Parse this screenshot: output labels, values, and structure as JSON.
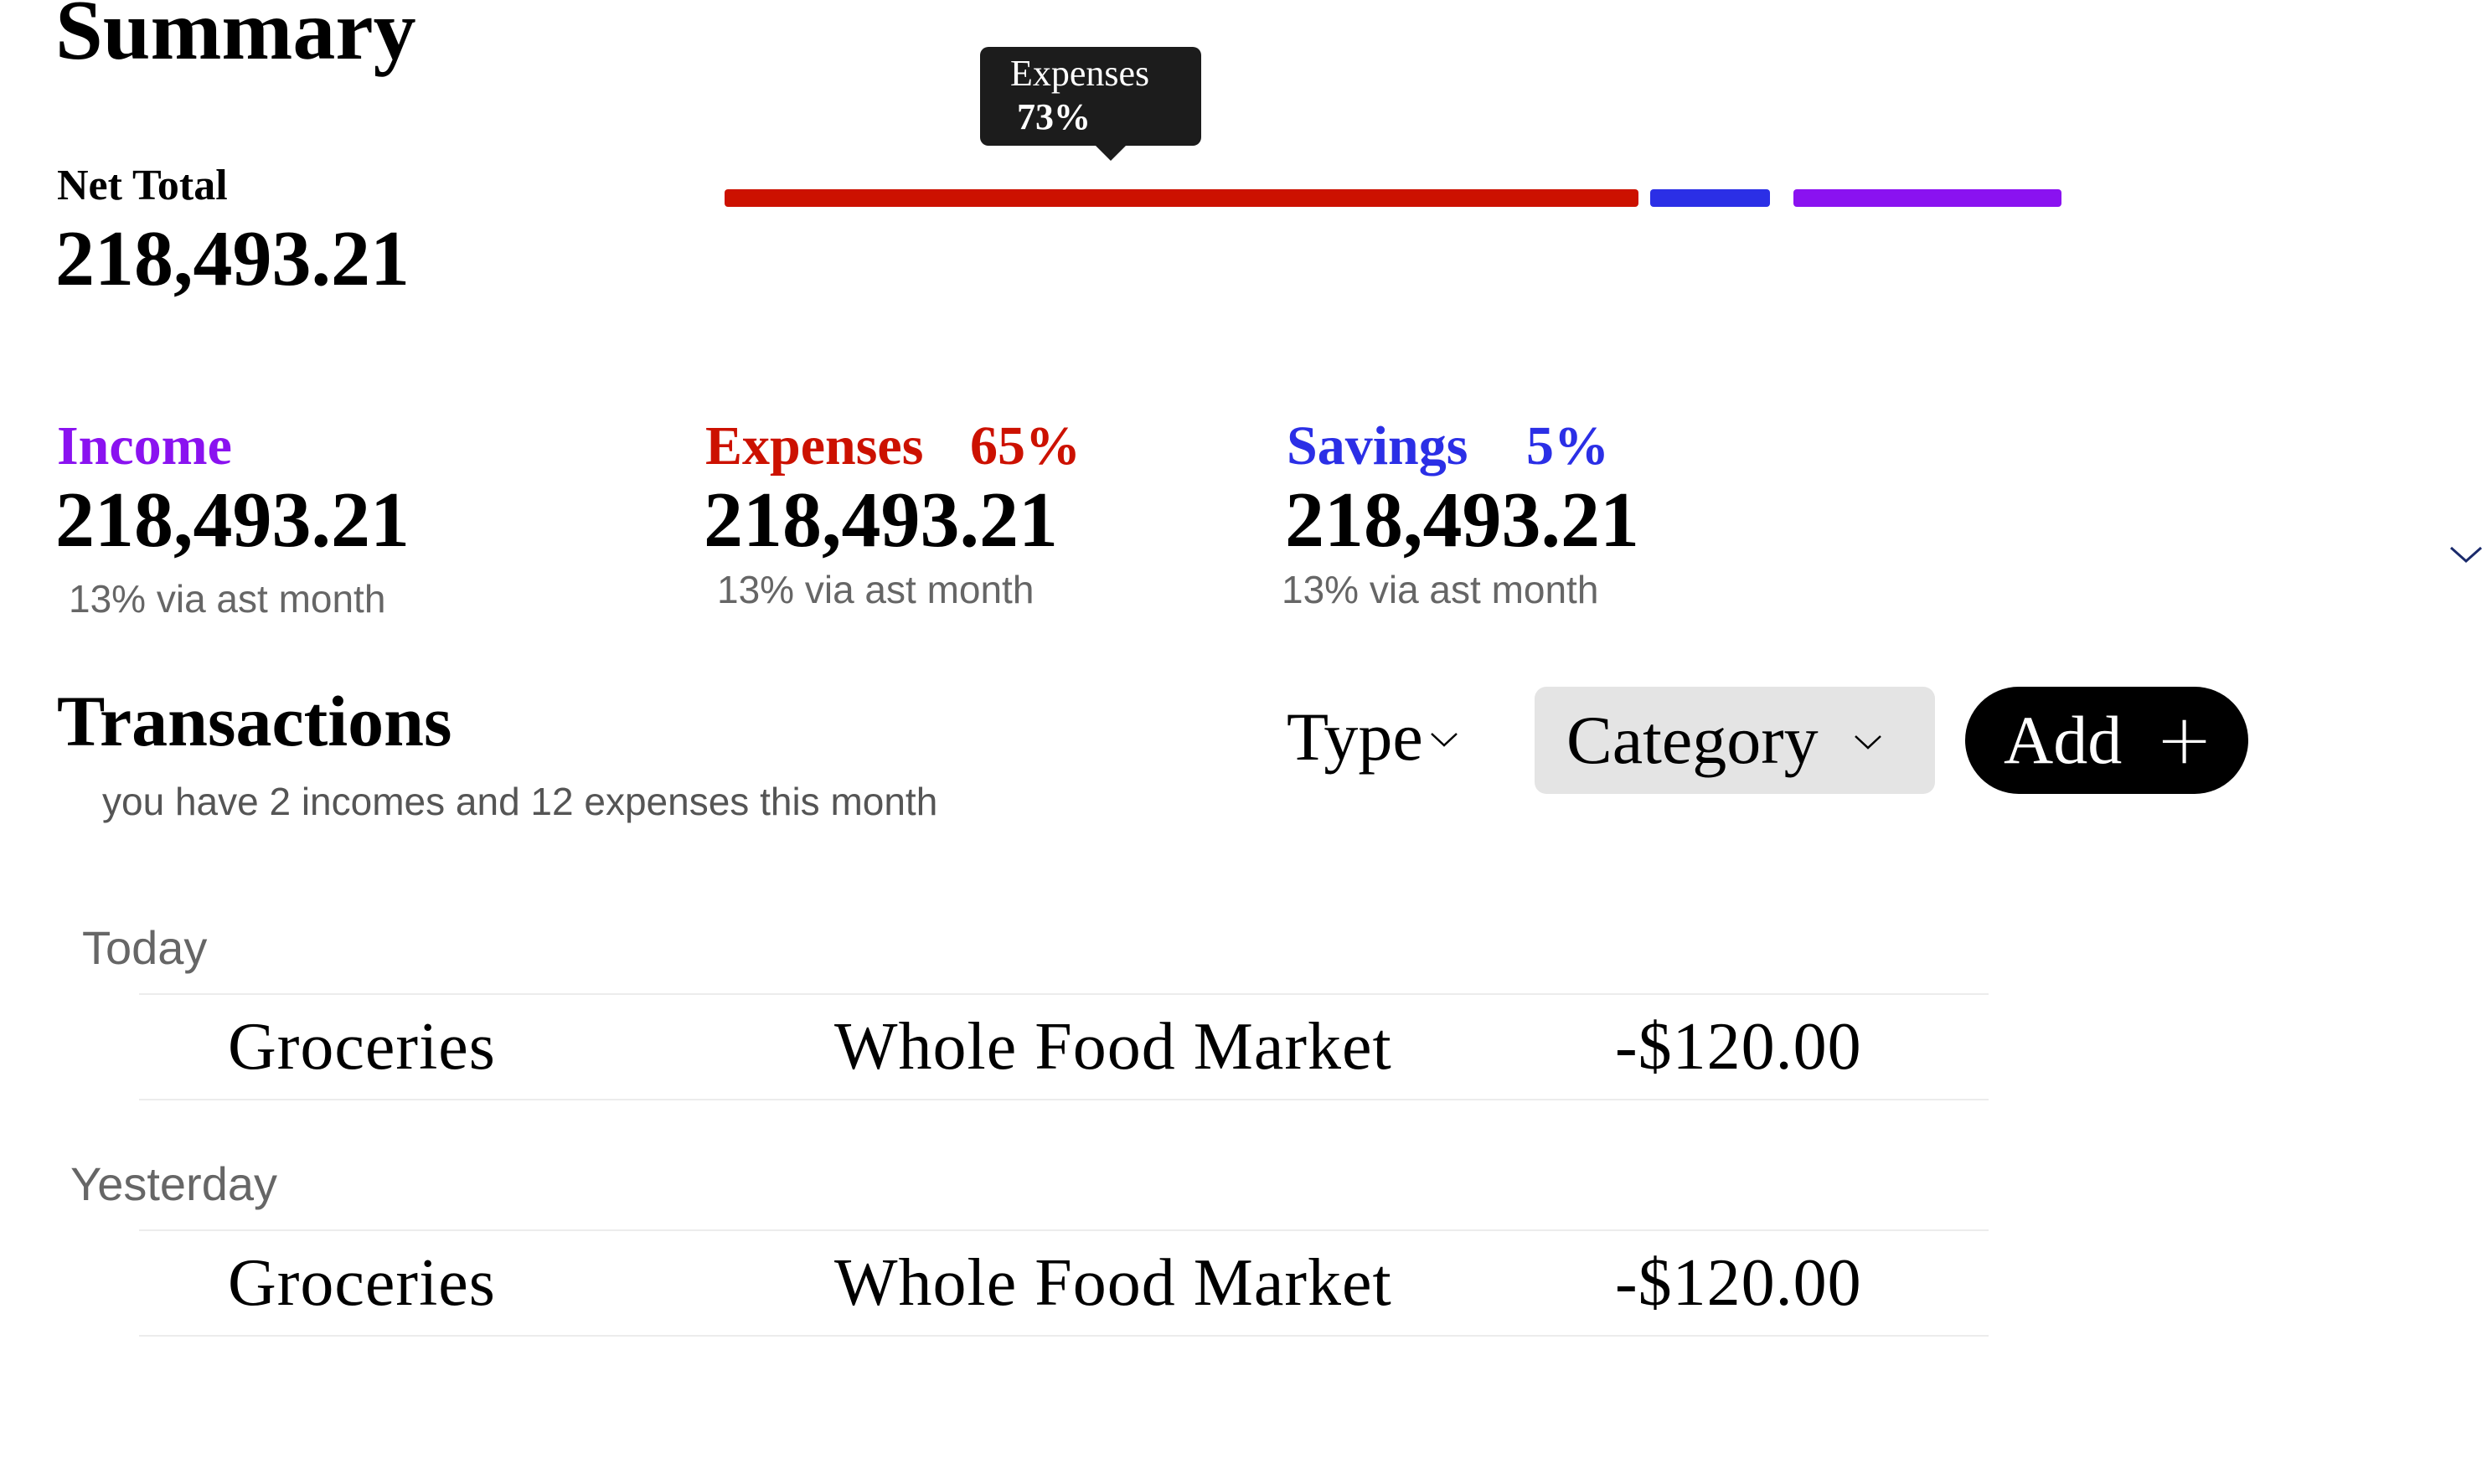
{
  "summary": {
    "title": "Summary",
    "net_label": "Net Total",
    "net_value": "218,493.21"
  },
  "breakdown": {
    "segments": [
      {
        "name": "Expenses",
        "color": "#cc1100"
      },
      {
        "name": "Savings",
        "color": "#2b2fe6"
      },
      {
        "name": "Income",
        "color": "#8a12f0"
      }
    ],
    "tooltip": {
      "label": "Expenses",
      "value": "73%"
    }
  },
  "stats": {
    "income": {
      "label": "Income",
      "value": "218,493.21",
      "note": "13% via ast month",
      "color": "#8a12f0"
    },
    "expenses": {
      "label": "Expenses",
      "percent": "65%",
      "value": "218,493.21",
      "note": "13% via ast month",
      "color": "#cc1100"
    },
    "savings": {
      "label": "Savings",
      "percent": "5%",
      "value": "218,493.21",
      "note": "13% via ast month",
      "color": "#2b2fe6"
    },
    "collapse_icon": "chevron-down-icon"
  },
  "transactions": {
    "title": "Transactions",
    "subtitle": "you have 2 incomes and 12 expenses this month",
    "filters": {
      "type_label": "Type",
      "category_label": "Category"
    },
    "add_label": "Add",
    "add_icon": "plus-icon",
    "groups": [
      {
        "label": "Today",
        "rows": [
          {
            "category": "Groceries",
            "merchant": "Whole Food Market",
            "amount": "-$120.00"
          }
        ]
      },
      {
        "label": "Yesterday",
        "rows": [
          {
            "category": "Groceries",
            "merchant": "Whole Food Market",
            "amount": "-$120.00"
          }
        ]
      }
    ]
  }
}
